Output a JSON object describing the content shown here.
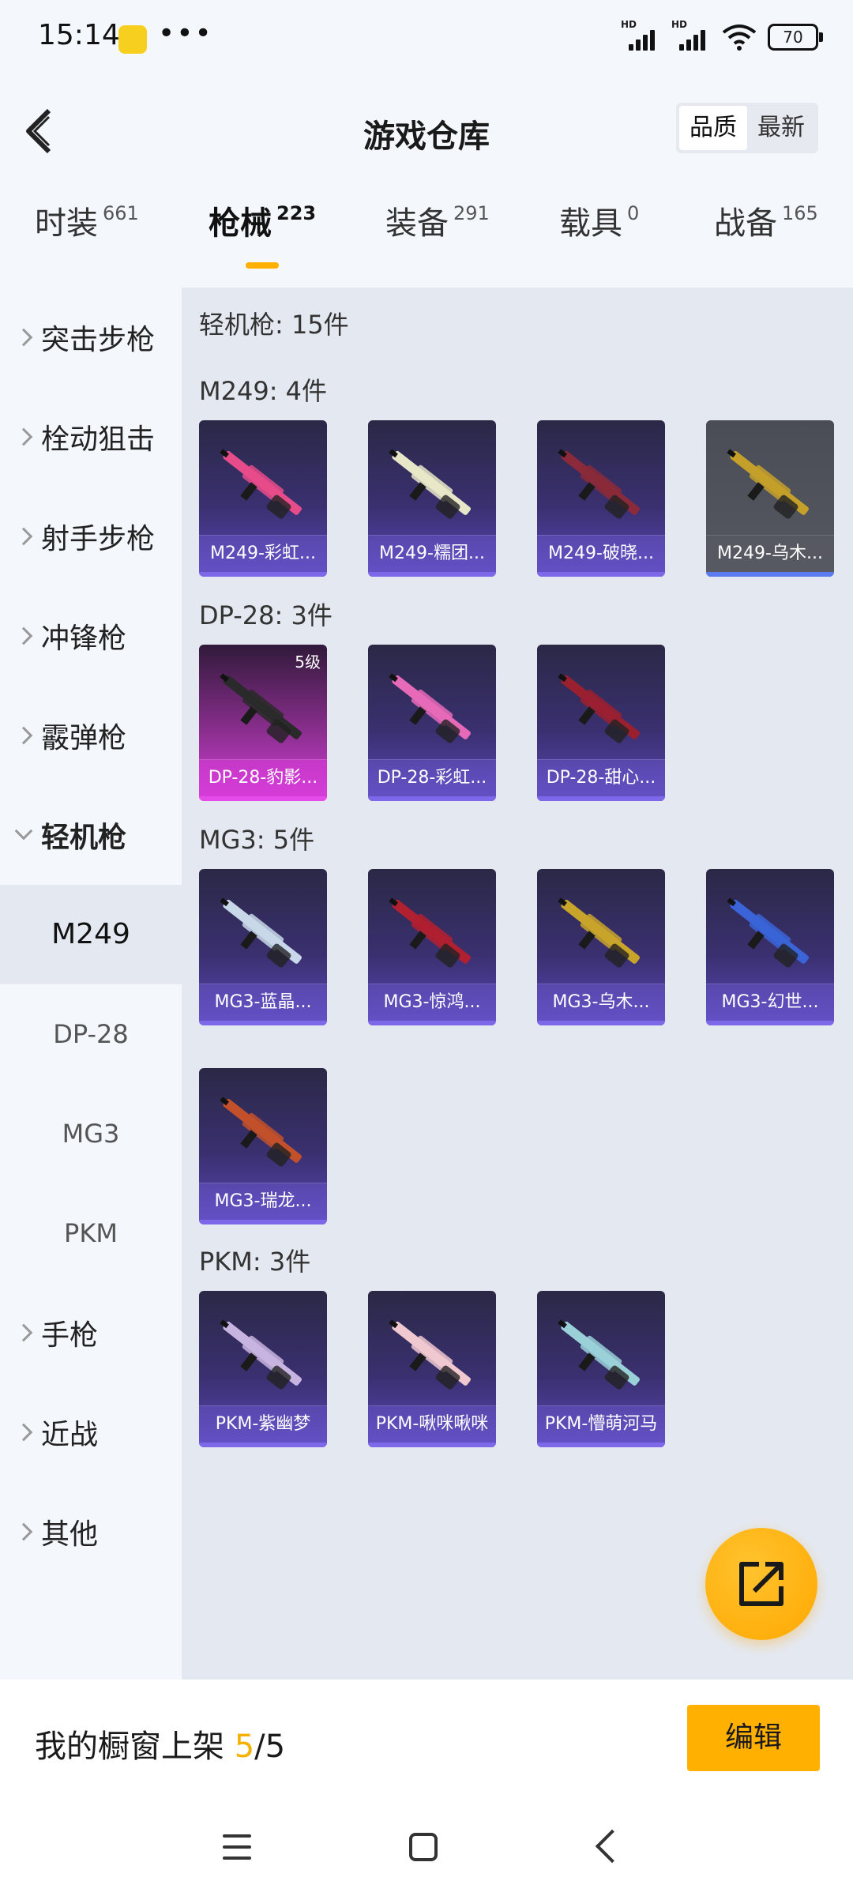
{
  "status": {
    "time": "15:14",
    "dots": "•••",
    "battery": "70",
    "hd1": "HD",
    "hd2": "HD"
  },
  "header": {
    "title": "游戏仓库",
    "sort": [
      "品质",
      "最新"
    ]
  },
  "tabs": [
    {
      "label": "时装",
      "count": "661"
    },
    {
      "label": "枪械",
      "count": "223"
    },
    {
      "label": "装备",
      "count": "291"
    },
    {
      "label": "载具",
      "count": "0"
    },
    {
      "label": "战备",
      "count": "165"
    }
  ],
  "sidebar": {
    "items": [
      "突击步枪",
      "栓动狙击",
      "射手步枪",
      "冲锋枪",
      "霰弹枪",
      "轻机枪",
      "手枪",
      "近战",
      "其他"
    ],
    "sub": [
      "M249",
      "DP-28",
      "MG3",
      "PKM"
    ]
  },
  "content": {
    "total": "轻机枪: 15件",
    "groups": [
      {
        "label": "M249: 4件",
        "items": [
          {
            "name": "M249-彩虹...",
            "color": "#e64b8a"
          },
          {
            "name": "M249-糯团...",
            "color": "#e8e6c8"
          },
          {
            "name": "M249-破晓...",
            "color": "#8a2a3a"
          },
          {
            "name": "M249-乌木...",
            "color": "#c4a02a"
          }
        ]
      },
      {
        "label": "DP-28: 3件",
        "items": [
          {
            "name": "DP-28-豹影...",
            "color": "#2a2a2a",
            "level": "5级"
          },
          {
            "name": "DP-28-彩虹...",
            "color": "#e66ab8"
          },
          {
            "name": "DP-28-甜心...",
            "color": "#9a2030"
          }
        ]
      },
      {
        "label": "MG3: 5件",
        "items": [
          {
            "name": "MG3-蓝晶...",
            "color": "#c8d8e8"
          },
          {
            "name": "MG3-惊鸿...",
            "color": "#b02030"
          },
          {
            "name": "MG3-乌木...",
            "color": "#c9a42a"
          },
          {
            "name": "MG3-幻世...",
            "color": "#3a64d8"
          },
          {
            "name": "MG3-瑞龙...",
            "color": "#c2502a"
          }
        ]
      },
      {
        "label": "PKM: 3件",
        "items": [
          {
            "name": "PKM-紫幽梦",
            "color": "#c8b4e0"
          },
          {
            "name": "PKM-啾咪啾咪",
            "color": "#f0c8d0"
          },
          {
            "name": "PKM-懵萌河马",
            "color": "#9ad0d8"
          }
        ]
      }
    ]
  },
  "bottom": {
    "label": "我的橱窗上架 ",
    "current": "5",
    "total": "/5",
    "edit": "编辑"
  },
  "icons": {
    "back": "back-arrow-icon",
    "share": "share-external-icon",
    "nav": [
      "menu-icon",
      "home-icon",
      "nav-back-icon"
    ]
  },
  "colors": {
    "accent": "#ffb000",
    "bg": "#f4f8fd",
    "content_bg": "#e4e9f1"
  }
}
